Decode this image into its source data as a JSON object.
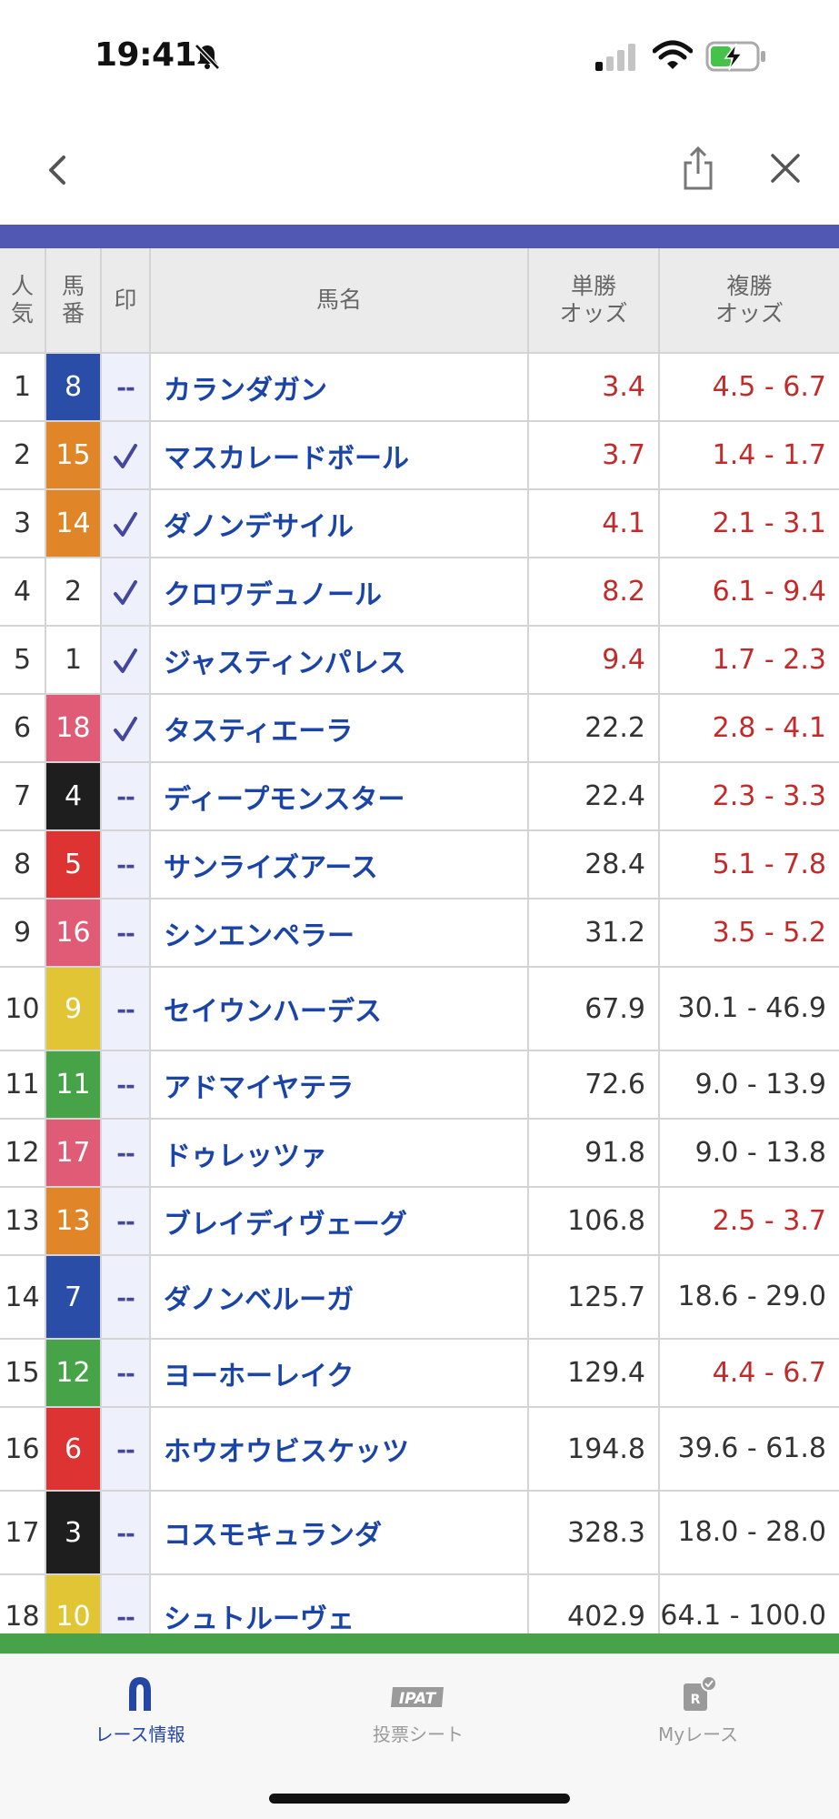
{
  "status_bar": {
    "time": "19:41"
  },
  "table": {
    "headers": {
      "rank": "人気",
      "horse_number": "馬番",
      "mark": "印",
      "name": "馬名",
      "win_odds": "単勝オッズ",
      "place_odds": "複勝オッズ"
    },
    "rows": [
      {
        "rank": "1",
        "number": "8",
        "frame_color": "#2a4ea8",
        "number_color": "#ffffff",
        "mark": "--",
        "name": "カランダガン",
        "win": "3.4",
        "win_highlight": true,
        "place": "4.5 - 6.7",
        "place_highlight": true
      },
      {
        "rank": "2",
        "number": "15",
        "frame_color": "#e08628",
        "number_color": "#ffffff",
        "mark": "✓",
        "name": "マスカレードボール",
        "win": "3.7",
        "win_highlight": true,
        "place": "1.4 - 1.7",
        "place_highlight": true
      },
      {
        "rank": "3",
        "number": "14",
        "frame_color": "#e08628",
        "number_color": "#ffffff",
        "mark": "✓",
        "name": "ダノンデサイル",
        "win": "4.1",
        "win_highlight": true,
        "place": "2.1 - 3.1",
        "place_highlight": true
      },
      {
        "rank": "4",
        "number": "2",
        "frame_color": "#ffffff",
        "number_color": "#333333",
        "mark": "✓",
        "name": "クロワデュノール",
        "win": "8.2",
        "win_highlight": true,
        "place": "6.1 - 9.4",
        "place_highlight": true
      },
      {
        "rank": "5",
        "number": "1",
        "frame_color": "#ffffff",
        "number_color": "#333333",
        "mark": "✓",
        "name": "ジャスティンパレス",
        "win": "9.4",
        "win_highlight": true,
        "place": "1.7 - 2.3",
        "place_highlight": true
      },
      {
        "rank": "6",
        "number": "18",
        "frame_color": "#e05c76",
        "number_color": "#ffffff",
        "mark": "✓",
        "name": "タスティエーラ",
        "win": "22.2",
        "win_highlight": false,
        "place": "2.8 - 4.1",
        "place_highlight": true
      },
      {
        "rank": "7",
        "number": "4",
        "frame_color": "#1e1e1e",
        "number_color": "#ffffff",
        "mark": "--",
        "name": "ディープモンスター",
        "win": "22.4",
        "win_highlight": false,
        "place": "2.3 - 3.3",
        "place_highlight": true
      },
      {
        "rank": "8",
        "number": "5",
        "frame_color": "#dd3333",
        "number_color": "#ffffff",
        "mark": "--",
        "name": "サンライズアース",
        "win": "28.4",
        "win_highlight": false,
        "place": "5.1 - 7.8",
        "place_highlight": true
      },
      {
        "rank": "9",
        "number": "16",
        "frame_color": "#e05c76",
        "number_color": "#ffffff",
        "mark": "--",
        "name": "シンエンペラー",
        "win": "31.2",
        "win_highlight": false,
        "place": "3.5 - 5.2",
        "place_highlight": true
      },
      {
        "rank": "10",
        "number": "9",
        "frame_color": "#e2c534",
        "number_color": "#ffffff",
        "mark": "--",
        "name": "セイウンハーデス",
        "win": "67.9",
        "win_highlight": false,
        "place": "30.1 - 46.9",
        "place_highlight": false
      },
      {
        "rank": "11",
        "number": "11",
        "frame_color": "#47a347",
        "number_color": "#ffffff",
        "mark": "--",
        "name": "アドマイヤテラ",
        "win": "72.6",
        "win_highlight": false,
        "place": "9.0 - 13.9",
        "place_highlight": false
      },
      {
        "rank": "12",
        "number": "17",
        "frame_color": "#e05c76",
        "number_color": "#ffffff",
        "mark": "--",
        "name": "ドゥレッツァ",
        "win": "91.8",
        "win_highlight": false,
        "place": "9.0 - 13.8",
        "place_highlight": false
      },
      {
        "rank": "13",
        "number": "13",
        "frame_color": "#e08628",
        "number_color": "#ffffff",
        "mark": "--",
        "name": "ブレイディヴェーグ",
        "win": "106.8",
        "win_highlight": false,
        "place": "2.5 - 3.7",
        "place_highlight": true
      },
      {
        "rank": "14",
        "number": "7",
        "frame_color": "#2a4ea8",
        "number_color": "#ffffff",
        "mark": "--",
        "name": "ダノンベルーガ",
        "win": "125.7",
        "win_highlight": false,
        "place": "18.6 - 29.0",
        "place_highlight": false
      },
      {
        "rank": "15",
        "number": "12",
        "frame_color": "#47a347",
        "number_color": "#ffffff",
        "mark": "--",
        "name": "ヨーホーレイク",
        "win": "129.4",
        "win_highlight": false,
        "place": "4.4 - 6.7",
        "place_highlight": true
      },
      {
        "rank": "16",
        "number": "6",
        "frame_color": "#dd3333",
        "number_color": "#ffffff",
        "mark": "--",
        "name": "ホウオウビスケッツ",
        "win": "194.8",
        "win_highlight": false,
        "place": "39.6 - 61.8",
        "place_highlight": false
      },
      {
        "rank": "17",
        "number": "3",
        "frame_color": "#1e1e1e",
        "number_color": "#ffffff",
        "mark": "--",
        "name": "コスモキュランダ",
        "win": "328.3",
        "win_highlight": false,
        "place": "18.0 - 28.0",
        "place_highlight": false
      },
      {
        "rank": "18",
        "number": "10",
        "frame_color": "#e2c534",
        "number_color": "#ffffff",
        "mark": "--",
        "name": "シュトルーヴェ",
        "win": "402.9",
        "win_highlight": false,
        "place": "64.1 - 100.0",
        "place_highlight": false
      }
    ]
  },
  "tab_bar": {
    "tabs": [
      {
        "label": "レース情報",
        "active": true,
        "icon": "horseshoe-icon"
      },
      {
        "label": "投票シート",
        "active": false,
        "icon": "ipat-icon",
        "icon_text": "IPAT"
      },
      {
        "label": "Myレース",
        "active": false,
        "icon": "my-race-icon",
        "icon_text": "R"
      }
    ]
  },
  "colors": {
    "header_strip": "#5058b4",
    "footer_strip": "#48a24a",
    "horse_name": "#1a44a8",
    "odds_highlight": "#c42a2a",
    "tab_active": "#2646a4"
  }
}
